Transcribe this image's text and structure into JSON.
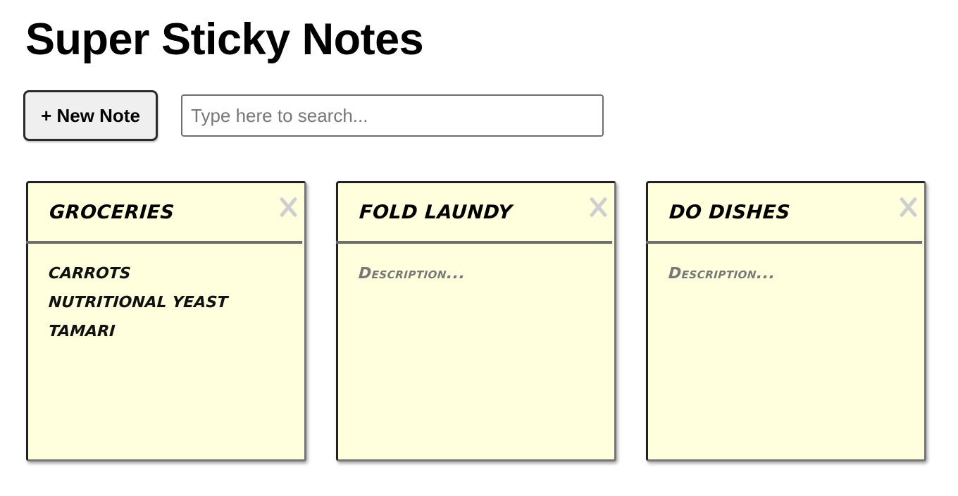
{
  "app": {
    "title": "Super Sticky Notes"
  },
  "controls": {
    "new_note_label": "+ New Note",
    "search_placeholder": "Type here to search...",
    "search_value": ""
  },
  "notes": [
    {
      "title": "groceries",
      "description_lines": [
        "carrots",
        "nutritional yeast",
        "tamari"
      ],
      "description_placeholder": "Description..."
    },
    {
      "title": "fold laundy",
      "description_lines": [],
      "description_placeholder": "Description..."
    },
    {
      "title": "do dishes",
      "description_lines": [],
      "description_placeholder": "Description..."
    }
  ],
  "icons": {
    "delete_note": "close-icon"
  },
  "colors": {
    "note_background": "#ffffde",
    "note_border": "#6f6f6f",
    "button_background": "#efefef",
    "close_icon": "#cfcfcf"
  }
}
